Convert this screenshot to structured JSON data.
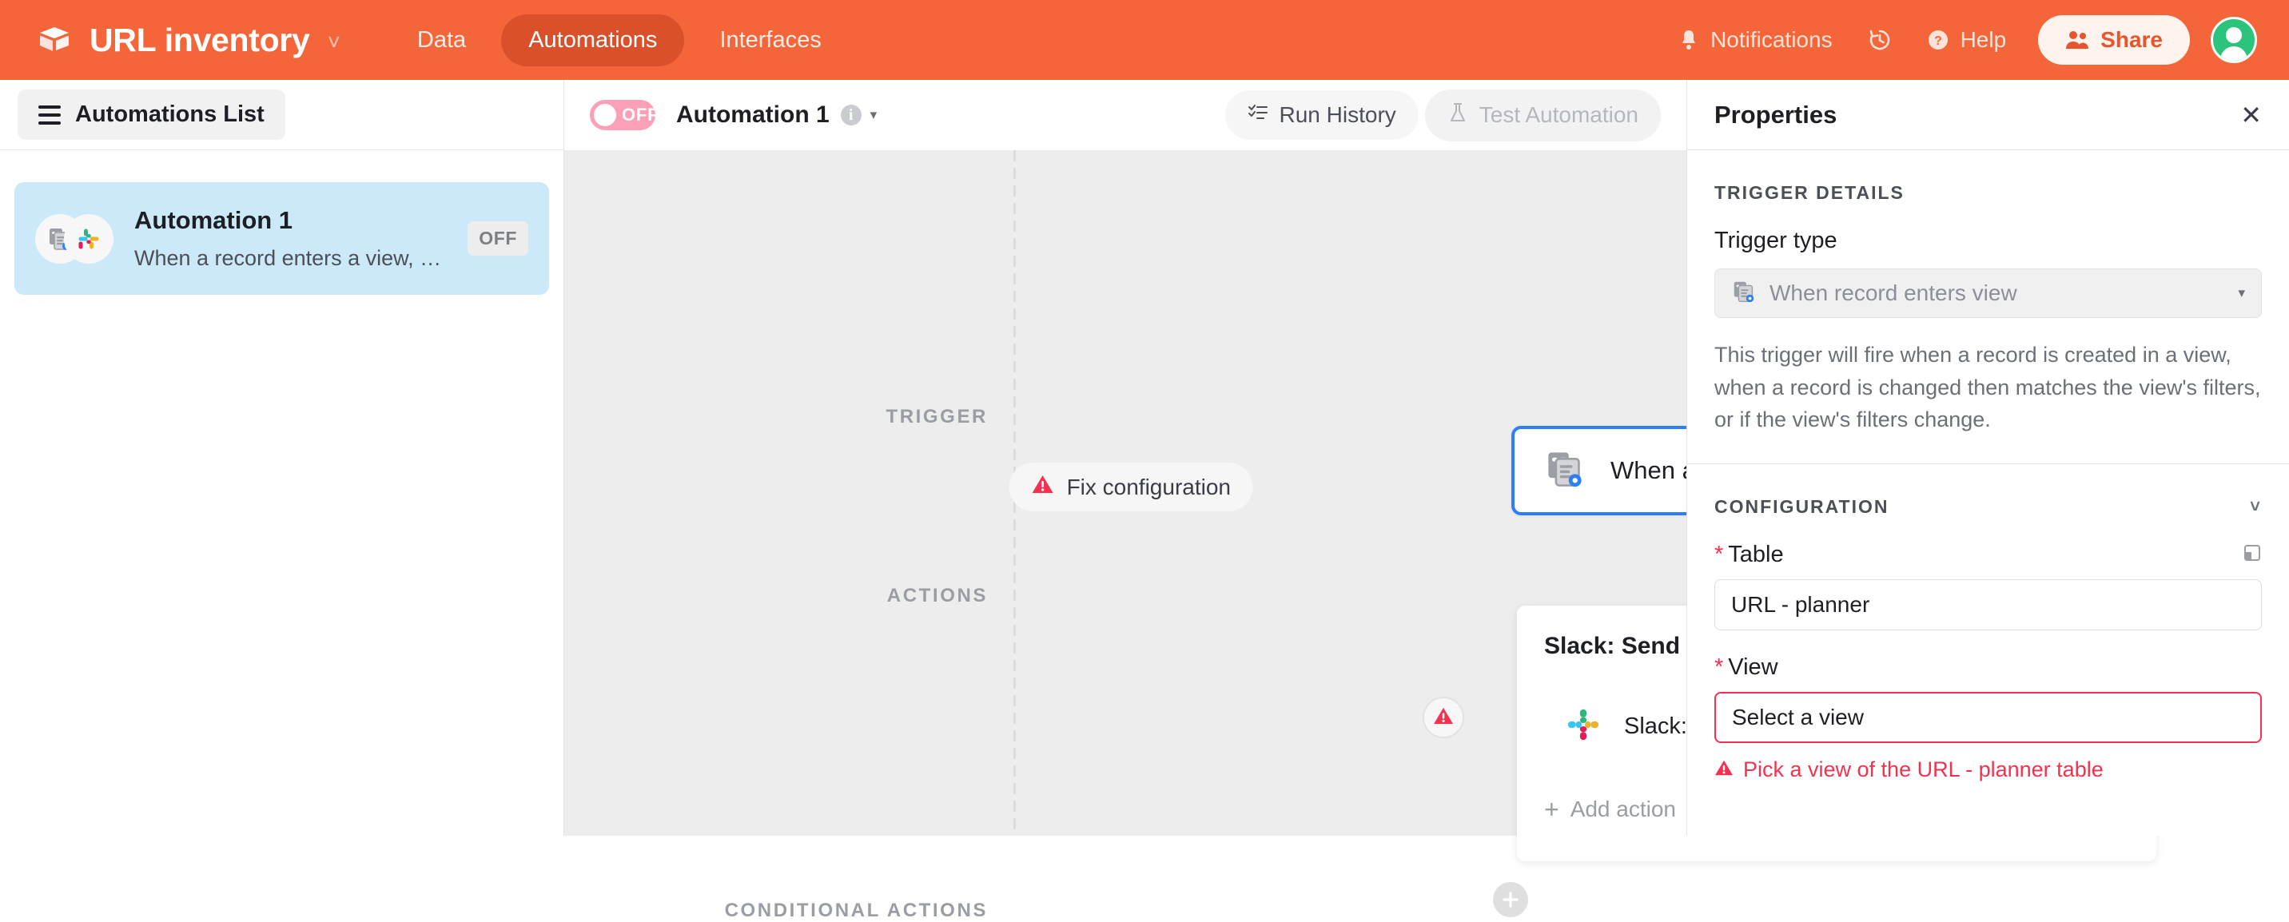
{
  "appbar": {
    "brand_name": "URL inventory",
    "brand_caret": "˅",
    "tabs": [
      {
        "label": "Data",
        "active": false
      },
      {
        "label": "Automations",
        "active": true
      },
      {
        "label": "Interfaces",
        "active": false
      }
    ],
    "notifications_label": "Notifications",
    "help_label": "Help",
    "share_label": "Share"
  },
  "sidebar": {
    "list_button_label": "Automations List",
    "items": [
      {
        "title": "Automation 1",
        "subtitle": "When a record enters a view, send a …",
        "status": "OFF"
      }
    ]
  },
  "canvas": {
    "toggle_state": "OFF",
    "automation_name": "Automation 1",
    "info_glyph": "i",
    "name_caret": "▾",
    "run_history_label": "Run History",
    "test_automation_label": "Test Automation",
    "section_labels": {
      "trigger": "TRIGGER",
      "actions": "ACTIONS",
      "conditional": "CONDITIONAL ACTIONS"
    },
    "fix_configuration_label": "Fix configuration",
    "trigger_card_label": "When a record enters a view",
    "action_card": {
      "title": "Slack: Send a message",
      "row_label": "Slack: Send a message",
      "add_action_label": "Add action",
      "plus": "+"
    }
  },
  "properties": {
    "title": "Properties",
    "close_glyph": "✕",
    "trigger_details_title": "TRIGGER DETAILS",
    "trigger_type_label": "Trigger type",
    "trigger_type_value": "When record enters view",
    "trigger_type_caret": "▾",
    "description": "This trigger will fire when a record is created in a view, when a record is changed then matches the view's filters, or if the view's filters change.",
    "configuration_title": "CONFIGURATION",
    "configuration_chevron": "˅",
    "table_label": "Table",
    "table_value": "URL - planner",
    "view_label": "View",
    "view_value": "Select a view",
    "required_star": "*",
    "error_message": "Pick a view of the URL - planner table"
  },
  "colors": {
    "brand_orange": "#F4663A",
    "tab_active": "#D9502A",
    "selection_blue": "#2D7FF9",
    "error_red": "#F5314F",
    "toggle_off_pink": "#FBA0B6",
    "sidebar_selected": "#CBE9F8",
    "canvas_bg": "#EDEDED",
    "avatar_green": "#2BC47C"
  }
}
